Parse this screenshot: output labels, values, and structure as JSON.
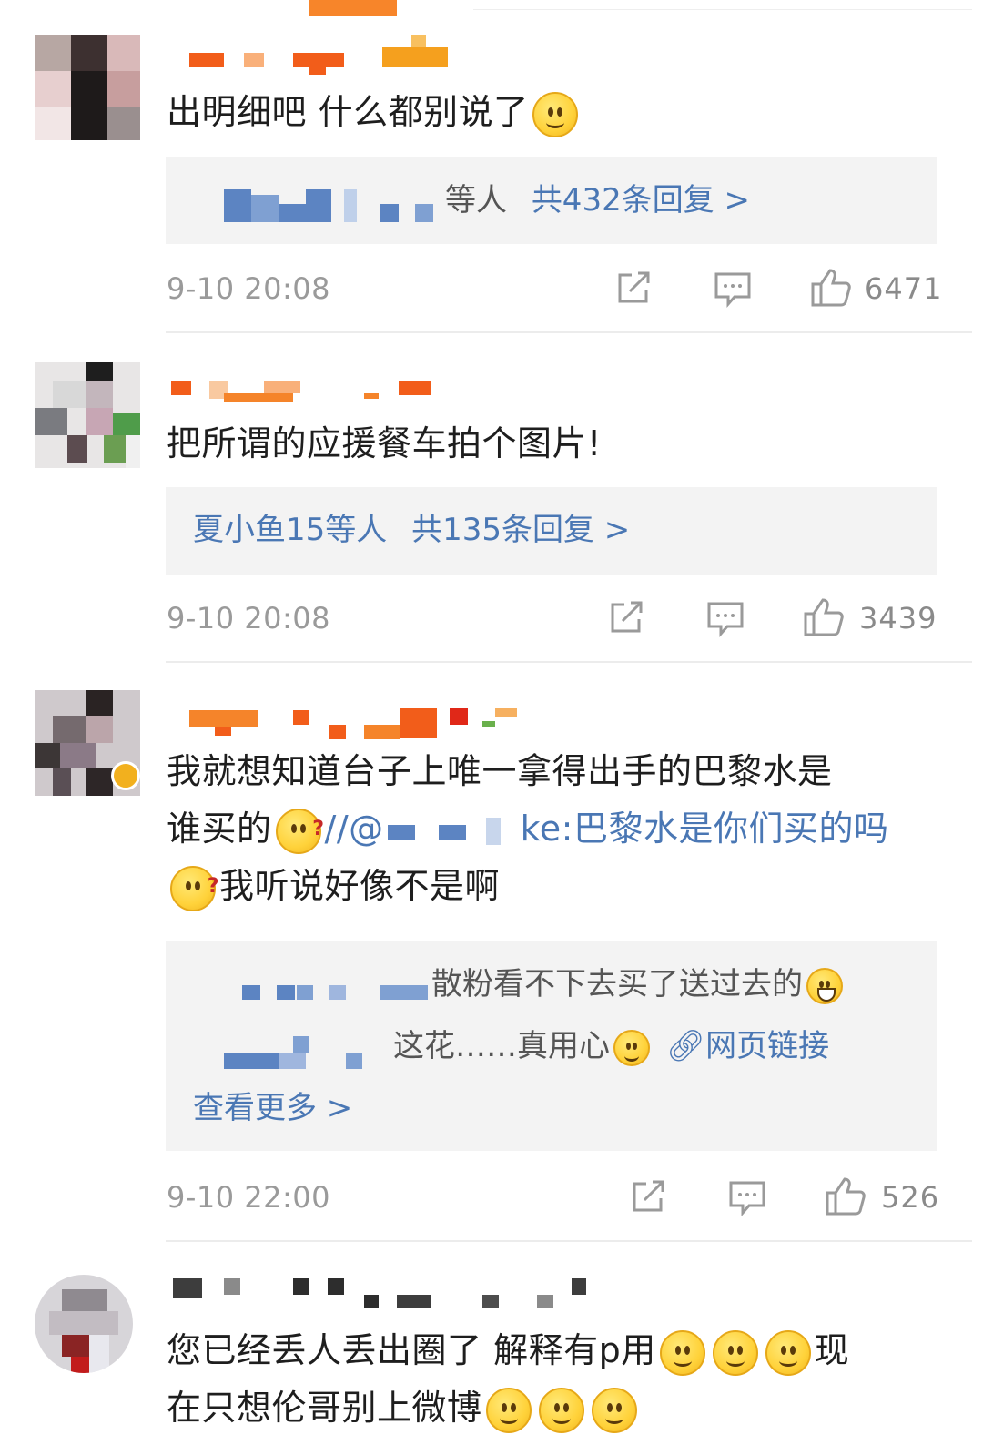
{
  "comments": [
    {
      "text": "出明细吧 什么都别说了",
      "reply_suffix": "等人",
      "reply_total": "共432条回复 >",
      "time": "9-10 20:08",
      "likes": "6471"
    },
    {
      "text": "把所谓的应援餐车拍个图片!",
      "reply_names": "夏小鱼15等人",
      "reply_total": "共135条回复 >",
      "time": "9-10 20:08",
      "likes": "3439"
    },
    {
      "text_line1": "我就想知道台子上唯一拿得出手的巴黎水是",
      "text_line2a": "谁买的",
      "text_line2b": "//@",
      "text_line2c": "ke:巴黎水是你们买的吗",
      "text_line3": "我听说好像不是啊",
      "reply1": "散粉看不下去买了送过去的",
      "reply2": "这花……真用心",
      "reply2_link": "网页链接",
      "view_more": "查看更多 >",
      "time": "9-10 22:00",
      "likes": "526"
    },
    {
      "text_line1a": "您已经丢人丢出圈了 解释有p用",
      "text_line1b": "现",
      "text_line2": "在只想伦哥别上微博"
    }
  ],
  "icons": {
    "share": "share-icon",
    "comment": "comment-icon",
    "like": "thumbs-up-icon",
    "link": "link-icon"
  },
  "colors": {
    "link": "#4a77b4",
    "reply_bg": "#f3f3f3",
    "meta": "#9a9a9a"
  }
}
